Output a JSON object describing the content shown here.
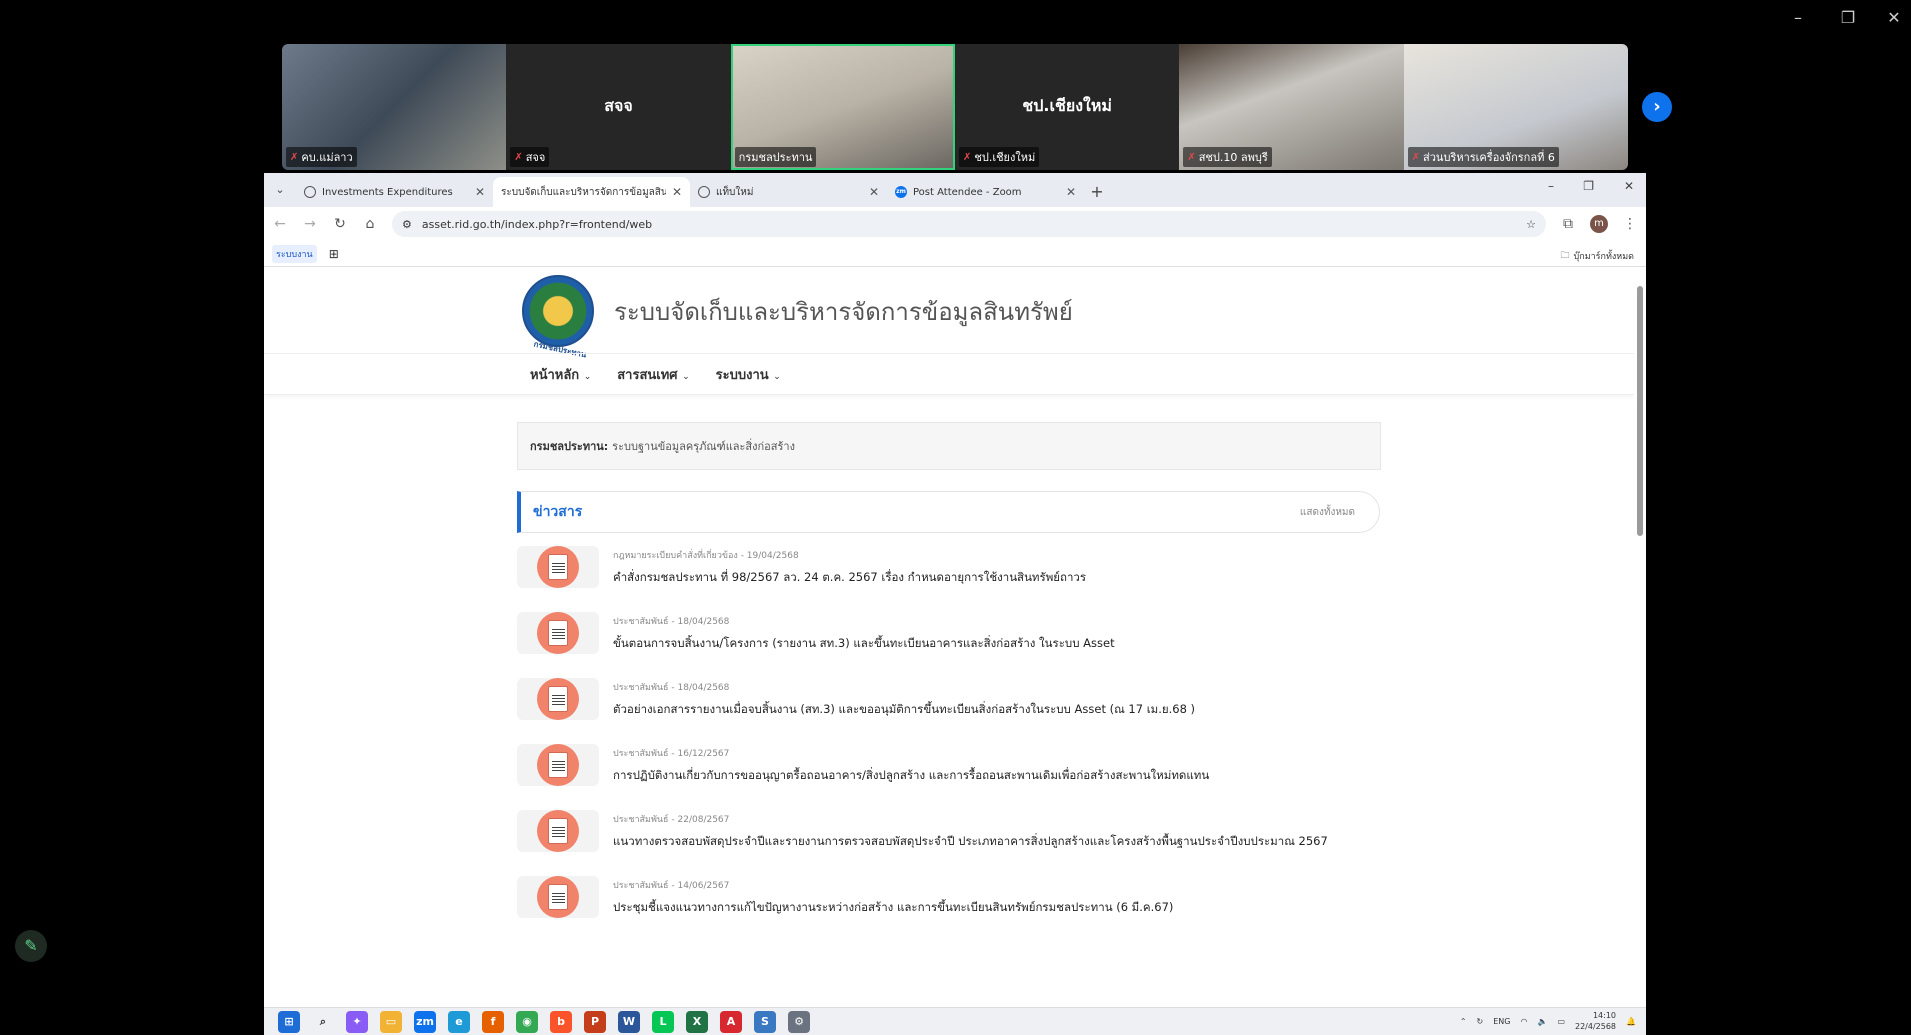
{
  "zoom": {
    "window_controls": [
      "–",
      "❐",
      "✕"
    ],
    "participants": [
      {
        "name": "คบ.แม่ลาว",
        "type": "video"
      },
      {
        "name": "สจจ",
        "type": "name"
      },
      {
        "name": "กรมชลประทาน",
        "type": "video"
      },
      {
        "name": "ชป.เชียงใหม่",
        "type": "name"
      },
      {
        "name": "สชป.10 ลพบุรี",
        "type": "video"
      },
      {
        "name": "ส่วนบริหารเครื่องจักรกลที่ 6",
        "type": "video"
      }
    ],
    "next_label": "›"
  },
  "browser": {
    "tabs": [
      {
        "title": "Investments Expenditures",
        "active": false
      },
      {
        "title": "ระบบจัดเก็บและบริหารจัดการข้อมูลสินทรัพย์",
        "active": true
      },
      {
        "title": "แท็บใหม่",
        "active": false
      },
      {
        "title": "Post Attendee - Zoom",
        "active": false
      }
    ],
    "url": "asset.rid.go.th/index.php?r=frontend/web",
    "avatar_letter": "m",
    "bookmarks": {
      "chip": "ระบบงาน",
      "right": "บุ๊กมาร์กทั้งหมด"
    }
  },
  "site": {
    "logo_text": "กรมชลประทาน",
    "title": "ระบบจัดเก็บและบริหารจัดการข้อมูลสินทรัพย์",
    "nav": [
      "หน้าหลัก",
      "สารสนเทศ",
      "ระบบงาน"
    ],
    "dept_label": "กรมชลประทาน:",
    "dept_text": "ระบบฐานข้อมูลครุภัณฑ์และสิ่งก่อสร้าง",
    "news_title": "ข่าวสาร",
    "news_all": "แสดงทั้งหมด",
    "news": [
      {
        "meta": "กฎหมายระเบียบคำสั่งที่เกี่ยวข้อง  -  19/04/2568",
        "headline": "คำสั่งกรมชลประทาน ที่ 98/2567 ลว. 24 ต.ค. 2567 เรื่อง กำหนดอายุการใช้งานสินทรัพย์ถาวร"
      },
      {
        "meta": "ประชาสัมพันธ์  -  18/04/2568",
        "headline": "ขั้นตอนการจบสิ้นงาน/โครงการ (รายงาน สท.3) และขึ้นทะเบียนอาคารและสิ่งก่อสร้าง ในระบบ Asset"
      },
      {
        "meta": "ประชาสัมพันธ์  -  18/04/2568",
        "headline": "ตัวอย่างเอกสารรายงานเมื่อจบสิ้นงาน (สท.3) และขออนุมัติการขึ้นทะเบียนสิ่งก่อสร้างในระบบ Asset (ณ 17 เม.ย.68 )"
      },
      {
        "meta": "ประชาสัมพันธ์  -  16/12/2567",
        "headline": "การปฏิบัติงานเกี่ยวกับการขออนุญาตรื้อถอนอาคาร/สิ่งปลูกสร้าง และการรื้อถอนสะพานเดิมเพื่อก่อสร้างสะพานใหม่ทดแทน"
      },
      {
        "meta": "ประชาสัมพันธ์  -  22/08/2567",
        "headline": "แนวทางตรวจสอบพัสดุประจำปีและรายงานการตรวจสอบพัสดุประจำปี ประเภทอาคารสิ่งปลูกสร้างและโครงสร้างพื้นฐานประจำปีงบประมาณ 2567"
      },
      {
        "meta": "ประชาสัมพันธ์  -  14/06/2567",
        "headline": "ประชุมชี้แจงแนวทางการแก้ไขปัญหางานระหว่างก่อสร้าง และการขึ้นทะเบียนสินทรัพย์กรมชลประทาน (6 มี.ค.67)"
      }
    ]
  },
  "taskbar": {
    "lang": "ENG",
    "time": "14:10",
    "date": "22/4/2568"
  }
}
